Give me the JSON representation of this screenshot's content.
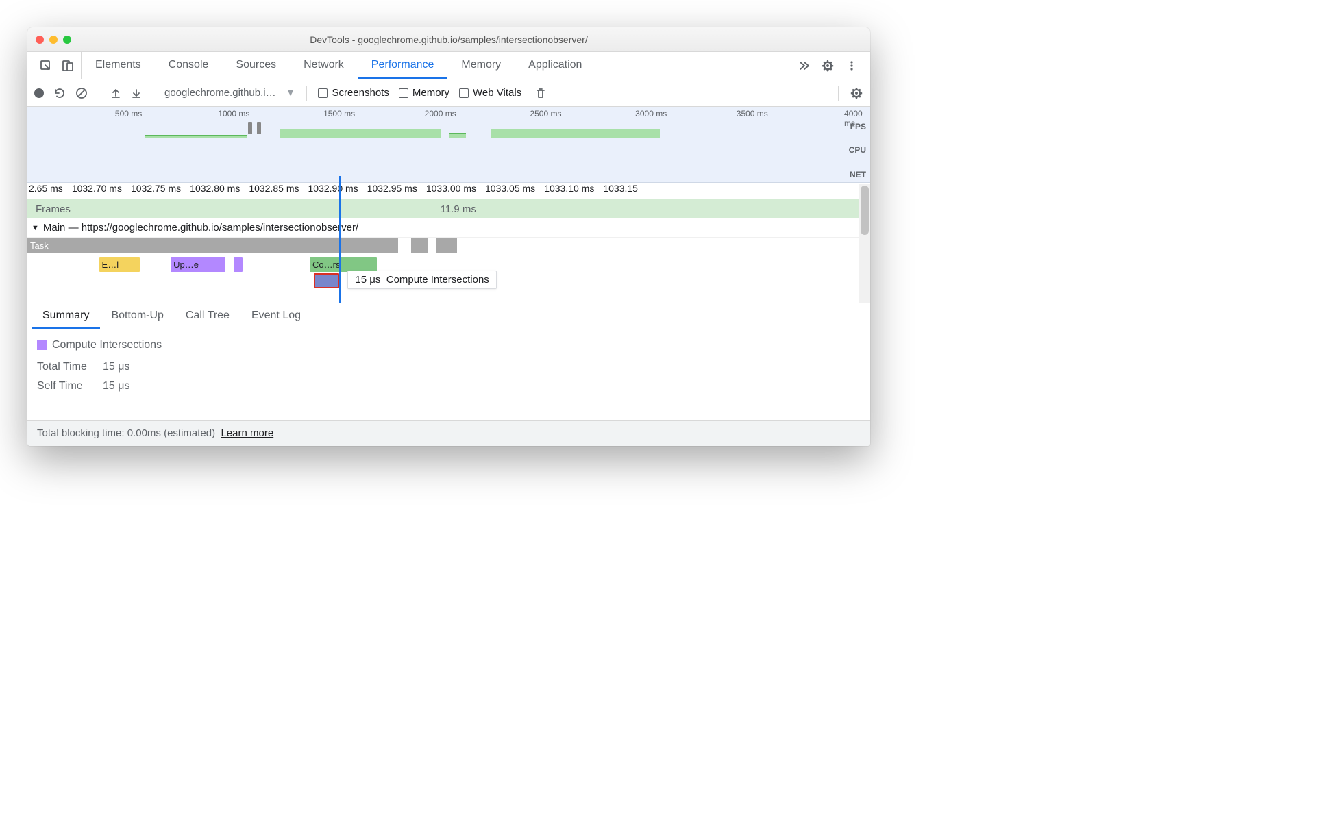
{
  "window": {
    "title": "DevTools - googlechrome.github.io/samples/intersectionobserver/"
  },
  "tabs": [
    "Elements",
    "Console",
    "Sources",
    "Network",
    "Performance",
    "Memory",
    "Application"
  ],
  "activeTab": "Performance",
  "toolbar": {
    "profile_select": "googlechrome.github.i…",
    "screenshots": "Screenshots",
    "memory": "Memory",
    "webvitals": "Web Vitals"
  },
  "overview": {
    "ticks": [
      "500 ms",
      "1000 ms",
      "1500 ms",
      "2000 ms",
      "2500 ms",
      "3000 ms",
      "3500 ms",
      "4000 ms"
    ],
    "rows": [
      "FPS",
      "CPU",
      "NET"
    ]
  },
  "detail": {
    "ticks": [
      "2.65 ms",
      "1032.70 ms",
      "1032.75 ms",
      "1032.80 ms",
      "1032.85 ms",
      "1032.90 ms",
      "1032.95 ms",
      "1033.00 ms",
      "1033.05 ms",
      "1033.10 ms",
      "1033.15"
    ],
    "frames_label": "Frames",
    "frames_value": "11.9 ms",
    "main_label": "Main — https://googlechrome.github.io/samples/intersectionobserver/",
    "task_label": "Task",
    "events": {
      "e": "E…l",
      "up": "Up…e",
      "co": "Co…rs"
    },
    "tooltip_time": "15 μs",
    "tooltip_name": "Compute Intersections"
  },
  "bottom_tabs": [
    "Summary",
    "Bottom-Up",
    "Call Tree",
    "Event Log"
  ],
  "summary": {
    "title": "Compute Intersections",
    "total_label": "Total Time",
    "total_value": "15 μs",
    "self_label": "Self Time",
    "self_value": "15 μs"
  },
  "footer": {
    "text": "Total blocking time: 0.00ms (estimated)",
    "link": "Learn more"
  }
}
